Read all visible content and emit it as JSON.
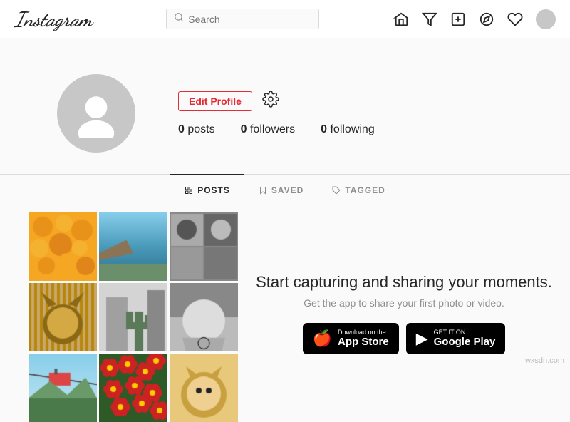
{
  "header": {
    "logo": "Instagram",
    "search_placeholder": "Search",
    "nav_icons": [
      "home",
      "filter",
      "plus-square",
      "compass",
      "heart",
      "avatar"
    ]
  },
  "profile": {
    "edit_button": "Edit Profile",
    "stats": {
      "posts_label": "posts",
      "posts_count": "0",
      "followers_label": "followers",
      "followers_count": "0",
      "following_label": "following",
      "following_count": "0"
    }
  },
  "tabs": [
    {
      "id": "posts",
      "label": "POSTS",
      "active": true
    },
    {
      "id": "saved",
      "label": "SAVED",
      "active": false
    },
    {
      "id": "tagged",
      "label": "TAGGED",
      "active": false
    }
  ],
  "promo": {
    "title": "Start capturing and sharing your moments.",
    "subtitle": "Get the app to share your first photo or video.",
    "app_store": {
      "small": "Download on the",
      "large": "App Store"
    },
    "google_play": {
      "small": "GET IT ON",
      "large": "Google Play"
    }
  },
  "watermark": "wxsdn.com"
}
